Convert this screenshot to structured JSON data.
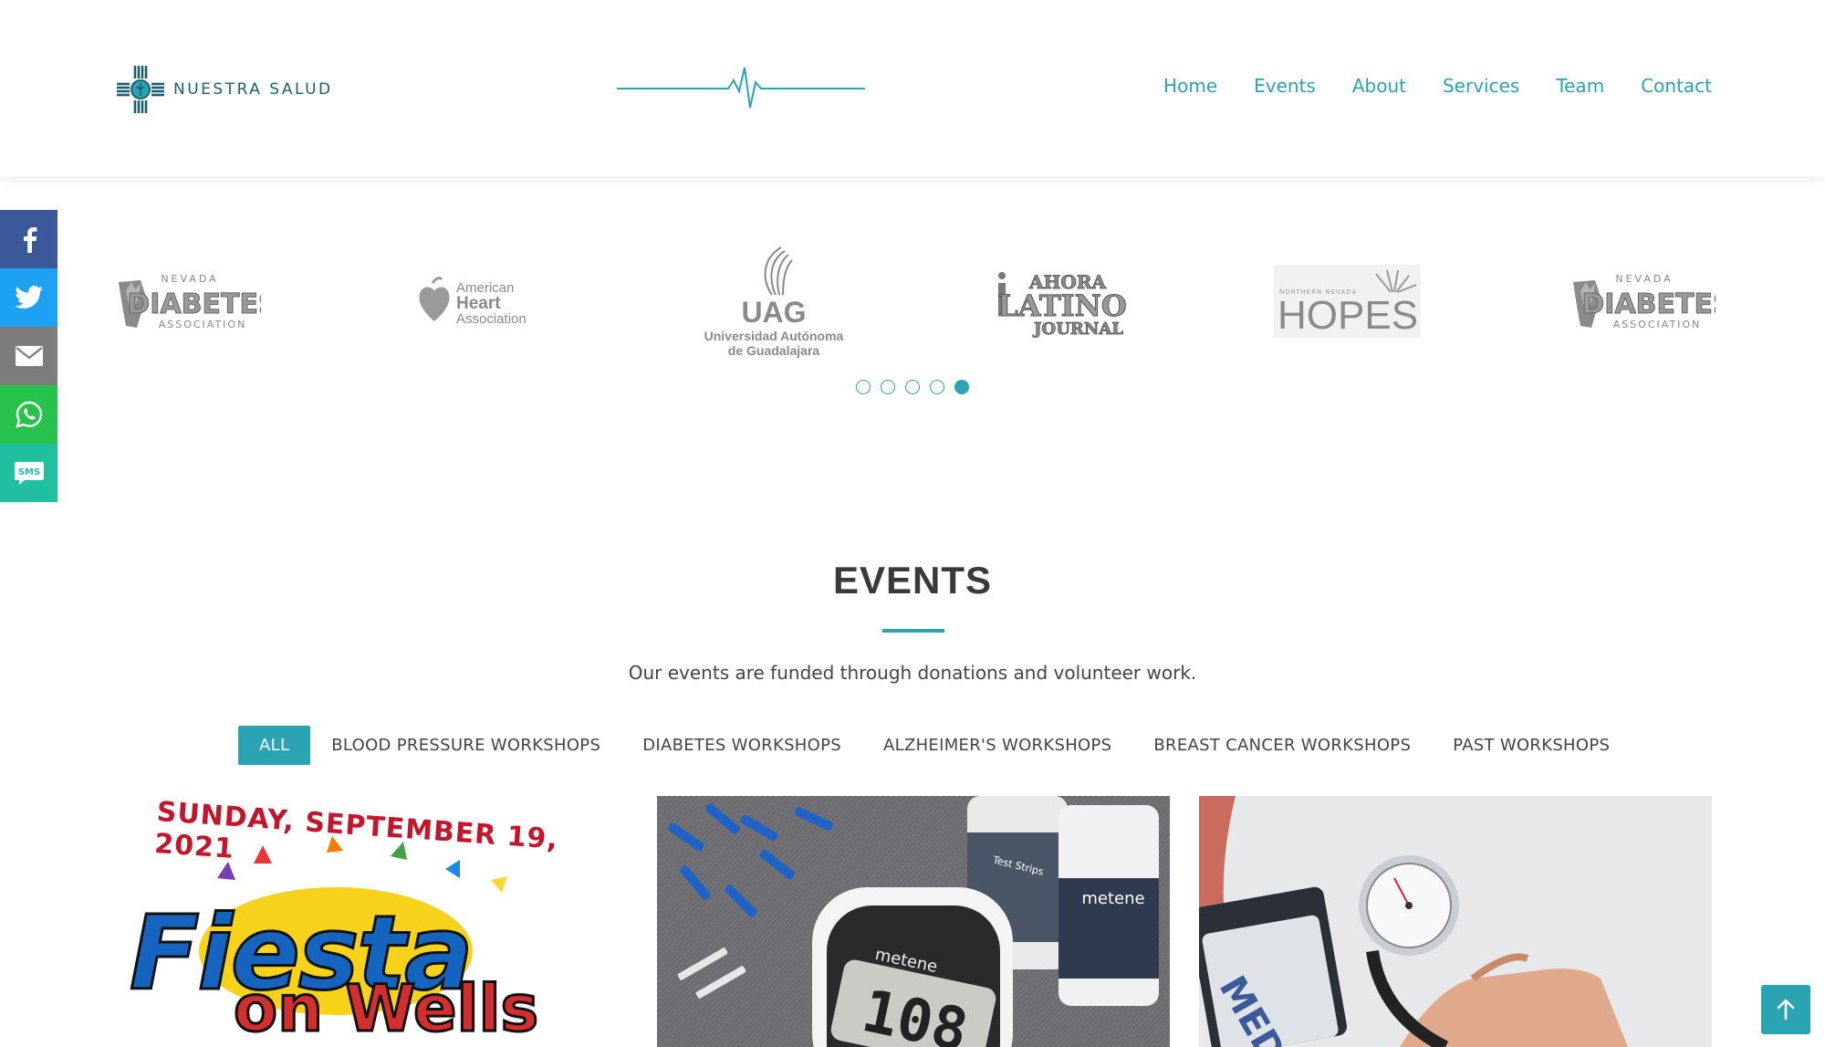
{
  "brand": {
    "name": "NUESTRA SALUD",
    "accent": "#2aa3b3"
  },
  "nav": [
    "Home",
    "Events",
    "About",
    "Services",
    "Team",
    "Contact"
  ],
  "social": [
    {
      "icon": "facebook-icon",
      "color": "#3b5998"
    },
    {
      "icon": "twitter-icon",
      "color": "#1da1f2"
    },
    {
      "icon": "email-icon",
      "color": "#7c7c7c"
    },
    {
      "icon": "whatsapp-icon",
      "color": "#27c24c"
    },
    {
      "icon": "sms-icon",
      "color": "#1fbf9f"
    }
  ],
  "partners": {
    "nevada": {
      "top": "NEVADA",
      "main": "DIABETES",
      "bottom": "ASSOCIATION"
    },
    "aha": {
      "line1": "American",
      "line2": "Heart",
      "line3": "Association"
    },
    "uag": {
      "abbr": "UAG",
      "line1": "Universidad Autónoma",
      "line2": "de Guadalajara"
    },
    "ahora": {
      "line1": "AHORA",
      "line2": "LATINO",
      "line3": "JOURNAL"
    },
    "hopes": {
      "small": "NORTHERN NEVADA",
      "main": "HOPES"
    },
    "sms_label": "SMS"
  },
  "carousel": {
    "dots": 5,
    "active_index": 4
  },
  "events": {
    "title": "EVENTS",
    "subtitle": "Our events are funded through donations and volunteer work.",
    "filters": [
      "ALL",
      "BLOOD PRESSURE WORKSHOPS",
      "DIABETES WORKSHOPS",
      "ALZHEIMER'S WORKSHOPS",
      "BREAST CANCER WORKSHOPS",
      "PAST WORKSHOPS"
    ],
    "active_filter": "ALL"
  },
  "cards": {
    "fiesta": {
      "date": "SUNDAY, SEPTEMBER 19, 2021",
      "word": "Fiesta",
      "sub": "on Wells"
    },
    "diabetes": {
      "meter_brand": "metene",
      "reading": "108",
      "strips_label": "Test Strips",
      "bottle_brand": "metene"
    },
    "bp": {
      "cuff_text": "MEDV"
    }
  }
}
